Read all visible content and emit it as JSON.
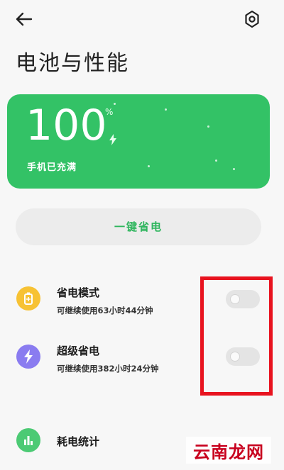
{
  "header": {
    "back_icon": "arrow-left-icon",
    "settings_icon": "gear-icon",
    "title": "电池与性能"
  },
  "battery_card": {
    "percent": "100",
    "percent_sign": "%",
    "status": "手机已充满",
    "color": "#33c266"
  },
  "one_tap_button": {
    "label": "一键省电",
    "color": "#2eb55d"
  },
  "modes": [
    {
      "title": "省电模式",
      "subtitle": "可继续使用63小时44分钟",
      "icon": "battery-icon",
      "icon_color": "#f7c234",
      "enabled": false
    },
    {
      "title": "超级省电",
      "subtitle": "可继续使用382小时24分钟",
      "icon": "lightning-icon",
      "icon_color": "#8a7cf0",
      "enabled": false
    }
  ],
  "stats": {
    "title": "耗电统计",
    "icon": "bar-chart-icon",
    "icon_color": "#4cca74"
  },
  "watermark": {
    "text": "云南龙网"
  }
}
